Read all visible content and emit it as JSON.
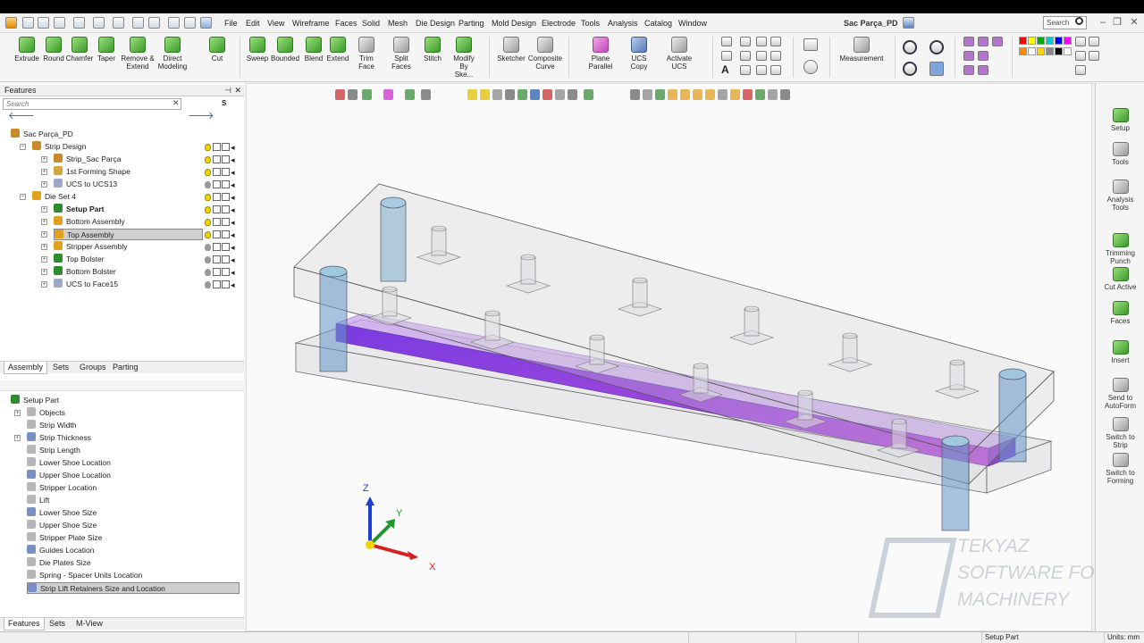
{
  "app": {
    "doc_title": "Sac Parça_PD",
    "search_placeholder": "Search"
  },
  "menu": [
    "File",
    "Edit",
    "View",
    "Wireframe",
    "Faces",
    "Solid",
    "Mesh",
    "Die Design",
    "Parting",
    "Mold Design",
    "Electrode",
    "Tools",
    "Analysis",
    "Catalog",
    "Window"
  ],
  "ribbon": {
    "buttons": [
      {
        "label": "Extrude"
      },
      {
        "label": "Round"
      },
      {
        "label": "Chamfer"
      },
      {
        "label": "Taper"
      },
      {
        "label": "Remove &\nExtend"
      },
      {
        "label": "Direct\nModeling"
      },
      {
        "label": "Cut"
      },
      {
        "label": "Sweep"
      },
      {
        "label": "Bounded"
      },
      {
        "label": "Blend"
      },
      {
        "label": "Extend"
      },
      {
        "label": "Trim Face"
      },
      {
        "label": "Split Faces"
      },
      {
        "label": "Stitch"
      },
      {
        "label": "Modify\nBy Ske..."
      },
      {
        "label": "Sketcher"
      },
      {
        "label": "Composite\nCurve"
      },
      {
        "label": "Plane Parallel"
      },
      {
        "label": "UCS\nCopy"
      },
      {
        "label": "Activate UCS"
      },
      {
        "label": "Measurement"
      }
    ],
    "palette_colors": [
      "#ff0000",
      "#ffff00",
      "#00aa00",
      "#00cccc",
      "#0000ff",
      "#ff00ff",
      "#ff8c00",
      "#ffffff",
      "#ffd700",
      "#888888",
      "#000000",
      "#ffffff"
    ]
  },
  "features_panel": {
    "title": "Features",
    "search_placeholder": "Search",
    "filter_letter": "S",
    "tree": [
      {
        "label": "Sac Parça_PD",
        "level": 0,
        "bold": false
      },
      {
        "label": "Strip Design",
        "level": 1,
        "bold": false
      },
      {
        "label": "Strip_Sac Parça",
        "level": 2,
        "bold": false
      },
      {
        "label": "1st Forming Shape",
        "level": 2,
        "bold": false
      },
      {
        "label": "UCS to UCS13",
        "level": 2,
        "bold": false
      },
      {
        "label": "Die Set 4",
        "level": 1,
        "bold": false
      },
      {
        "label": "Setup Part",
        "level": 2,
        "bold": true
      },
      {
        "label": "Bottom Assembly",
        "level": 2,
        "bold": false
      },
      {
        "label": "Top Assembly",
        "level": 2,
        "bold": false,
        "selected": true
      },
      {
        "label": "Stripper Assembly",
        "level": 2,
        "bold": false
      },
      {
        "label": "Top Bolster",
        "level": 2,
        "bold": false
      },
      {
        "label": "Bottom Bolster",
        "level": 2,
        "bold": false
      },
      {
        "label": "UCS to Face15",
        "level": 2,
        "bold": false
      }
    ],
    "tabs": [
      "Assembly",
      "Sets",
      "Groups",
      "Parting"
    ]
  },
  "setup_panel": {
    "items": [
      {
        "label": "Setup Part"
      },
      {
        "label": "Objects"
      },
      {
        "label": "Strip Width"
      },
      {
        "label": "Strip Thickness"
      },
      {
        "label": "Strip Length"
      },
      {
        "label": "Lower Shoe Location"
      },
      {
        "label": "Upper Shoe Location"
      },
      {
        "label": "Stripper Location"
      },
      {
        "label": "Lift"
      },
      {
        "label": "Lower Shoe Size"
      },
      {
        "label": "Upper Shoe Size"
      },
      {
        "label": "Stripper Plate Size"
      },
      {
        "label": "Guides Location"
      },
      {
        "label": "Die Plates Size"
      },
      {
        "label": "Spring - Spacer Units Location"
      },
      {
        "label": "Strip Lift Retainers Size and Location",
        "selected": true
      }
    ],
    "tabs": [
      "Features",
      "Sets",
      "M-View"
    ]
  },
  "right_toolbar": [
    {
      "label": "Setup"
    },
    {
      "label": "Tools"
    },
    {
      "label": "Analysis\nTools"
    },
    {
      "label": "Trimming\nPunch"
    },
    {
      "label": "Cut Active"
    },
    {
      "label": "Faces"
    },
    {
      "label": "Insert"
    },
    {
      "label": "Send to\nAutoForm"
    },
    {
      "label": "Switch to\nStrip"
    },
    {
      "label": "Switch to\nForming"
    }
  ],
  "triad": {
    "x": "X",
    "y": "Y",
    "z": "Z"
  },
  "watermark": {
    "line1": "TEKYAZ",
    "line2": "SOFTWARE FOR",
    "line3": "MACHINERY"
  },
  "status": {
    "mode": "Setup Part",
    "units": "Units: mm"
  }
}
